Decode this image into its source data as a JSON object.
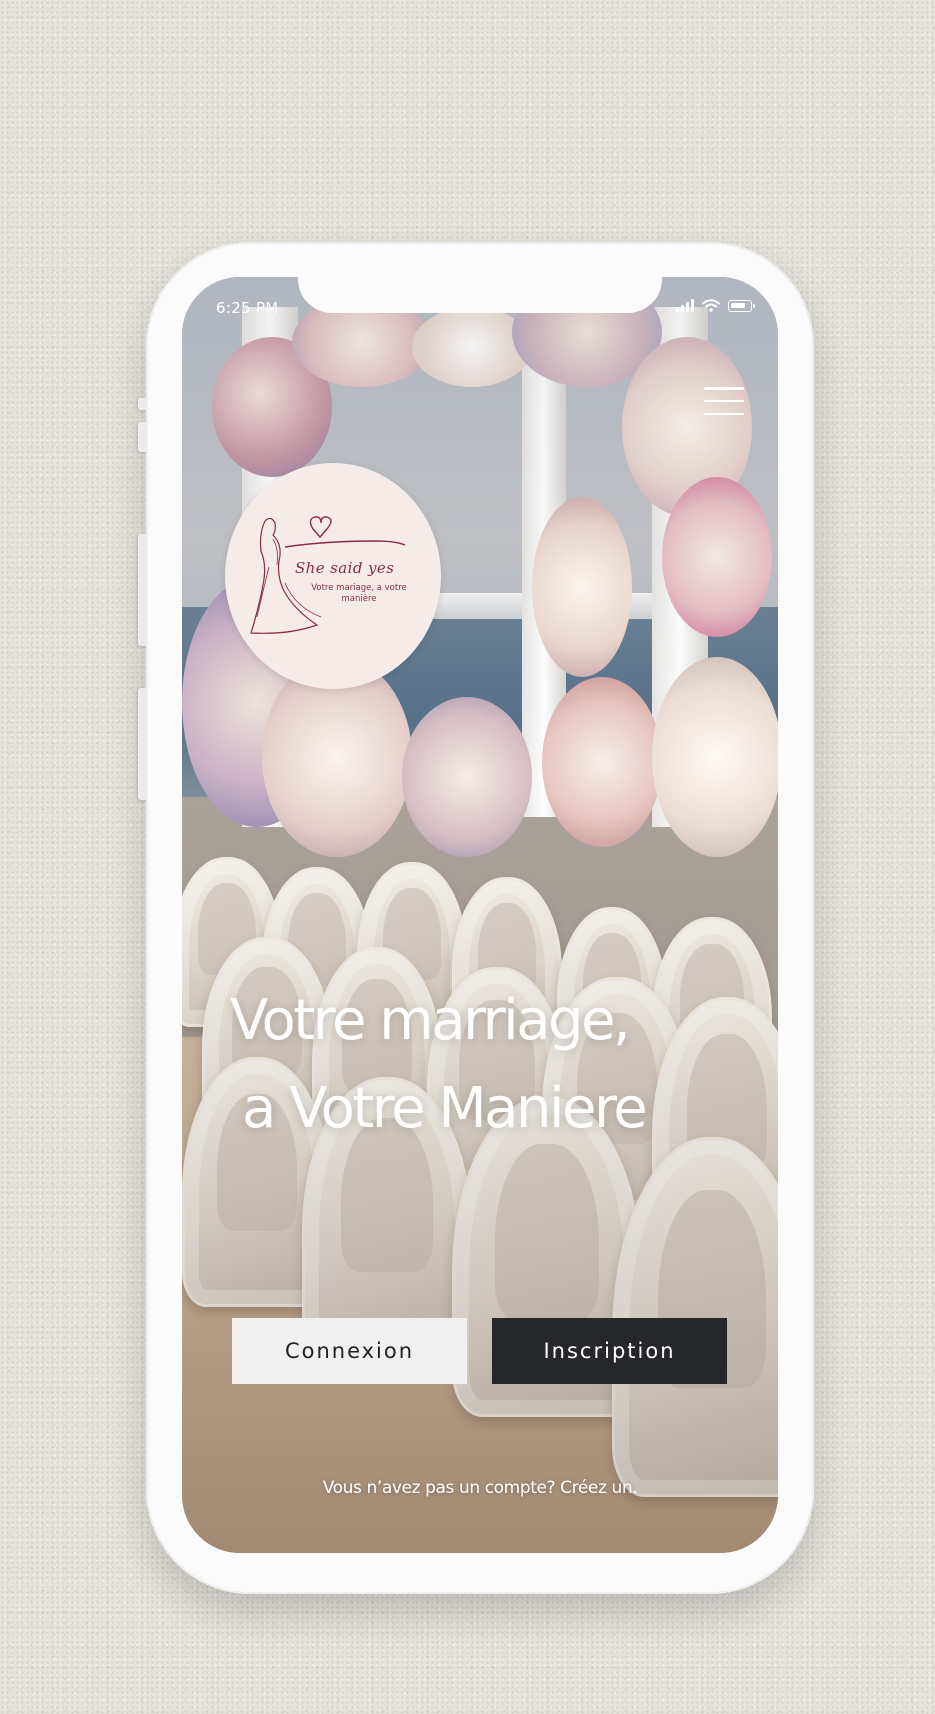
{
  "status_bar": {
    "time": "6:25 PM",
    "icons": [
      "cellular-signal-icon",
      "wifi-icon",
      "battery-icon"
    ]
  },
  "header": {
    "menu_icon": "hamburger-menu-icon"
  },
  "logo": {
    "name": "She said yes",
    "tagline": "Votre mariage, a votre manière",
    "brand_color": "#8c2a45",
    "background_color": "#f5ecea"
  },
  "hero": {
    "headline_line1": "Votre marriage,",
    "headline_line2": "a Votre Maniere"
  },
  "actions": {
    "login_label": "Connexion",
    "signup_label": "Inscription",
    "signup_prompt": "Vous n’avez pas un compte? Créez un."
  },
  "colors": {
    "page_background": "#e6e3dd",
    "phone_frame": "#fbfbfb",
    "login_button_bg": "#f0f0f0",
    "signup_button_bg": "#26272b",
    "text_on_image": "#ffffff"
  }
}
